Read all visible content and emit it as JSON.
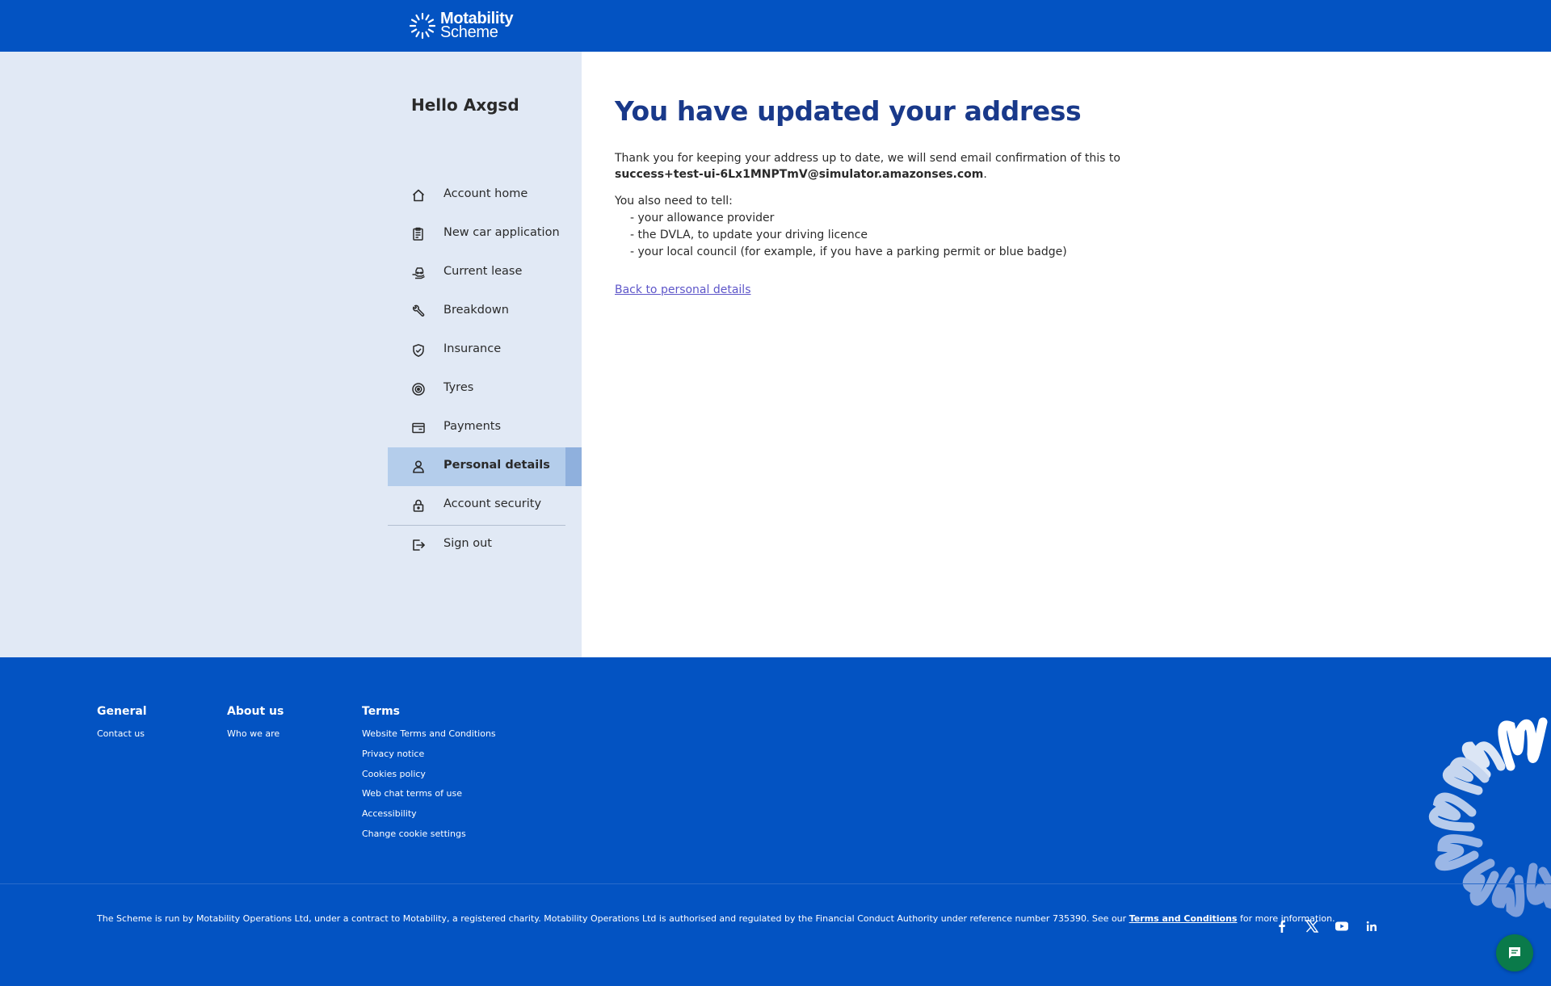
{
  "header": {
    "logo_line1": "Motability",
    "logo_line2": "Scheme"
  },
  "sidebar": {
    "greeting": "Hello Axgsd",
    "items": [
      {
        "label": "Account home",
        "icon": "home-icon"
      },
      {
        "label": "New car application",
        "icon": "clipboard-icon"
      },
      {
        "label": "Current lease",
        "icon": "hand-car-icon"
      },
      {
        "label": "Breakdown",
        "icon": "wrench-icon"
      },
      {
        "label": "Insurance",
        "icon": "shield-check-icon"
      },
      {
        "label": "Tyres",
        "icon": "tyre-icon"
      },
      {
        "label": "Payments",
        "icon": "card-icon"
      },
      {
        "label": "Personal details",
        "icon": "person-icon",
        "active": true
      },
      {
        "label": "Account security",
        "icon": "lock-icon"
      },
      {
        "label": "Sign out",
        "icon": "sign-out-icon"
      }
    ]
  },
  "main": {
    "title": "You have updated your address",
    "confirmation_text": "Thank you for keeping your address up to date, we will send email confirmation of this to",
    "email": "success+test-ui-6Lx1MNPTmV@simulator.amazonses.com",
    "email_suffix": ".",
    "also_tell": "You also need to tell:",
    "tell_list": [
      "- your allowance provider",
      "- the DVLA, to update your driving licence",
      "- your local council (for example, if you have a parking permit or blue badge)"
    ],
    "back_link": "Back to personal details"
  },
  "footer": {
    "general": {
      "heading": "General",
      "links": [
        "Contact us"
      ]
    },
    "about": {
      "heading": "About us",
      "links": [
        "Who we are"
      ]
    },
    "terms": {
      "heading": "Terms",
      "links": [
        "Website Terms and Conditions",
        "Privacy notice",
        "Cookies policy",
        "Web chat terms of use",
        "Accessibility",
        "Change cookie settings"
      ]
    },
    "legal_text": "The Scheme is run by Motability Operations Ltd, under a contract to Motability, a registered charity. Motability Operations Ltd is authorised and regulated by the Financial Conduct Authority under reference number 735390. See our",
    "legal_link": "Terms and Conditions",
    "legal_suffix": "for more information.",
    "socials": [
      "facebook-icon",
      "x-icon",
      "youtube-icon",
      "linkedin-icon"
    ]
  },
  "colors": {
    "brand_blue": "#0353c2",
    "sidebar_bg": "#e1e9f5",
    "active_item": "#b4cdeb",
    "title_blue": "#19398a",
    "link_purple": "#5e56c9",
    "chat_green": "#0a7a4a"
  }
}
